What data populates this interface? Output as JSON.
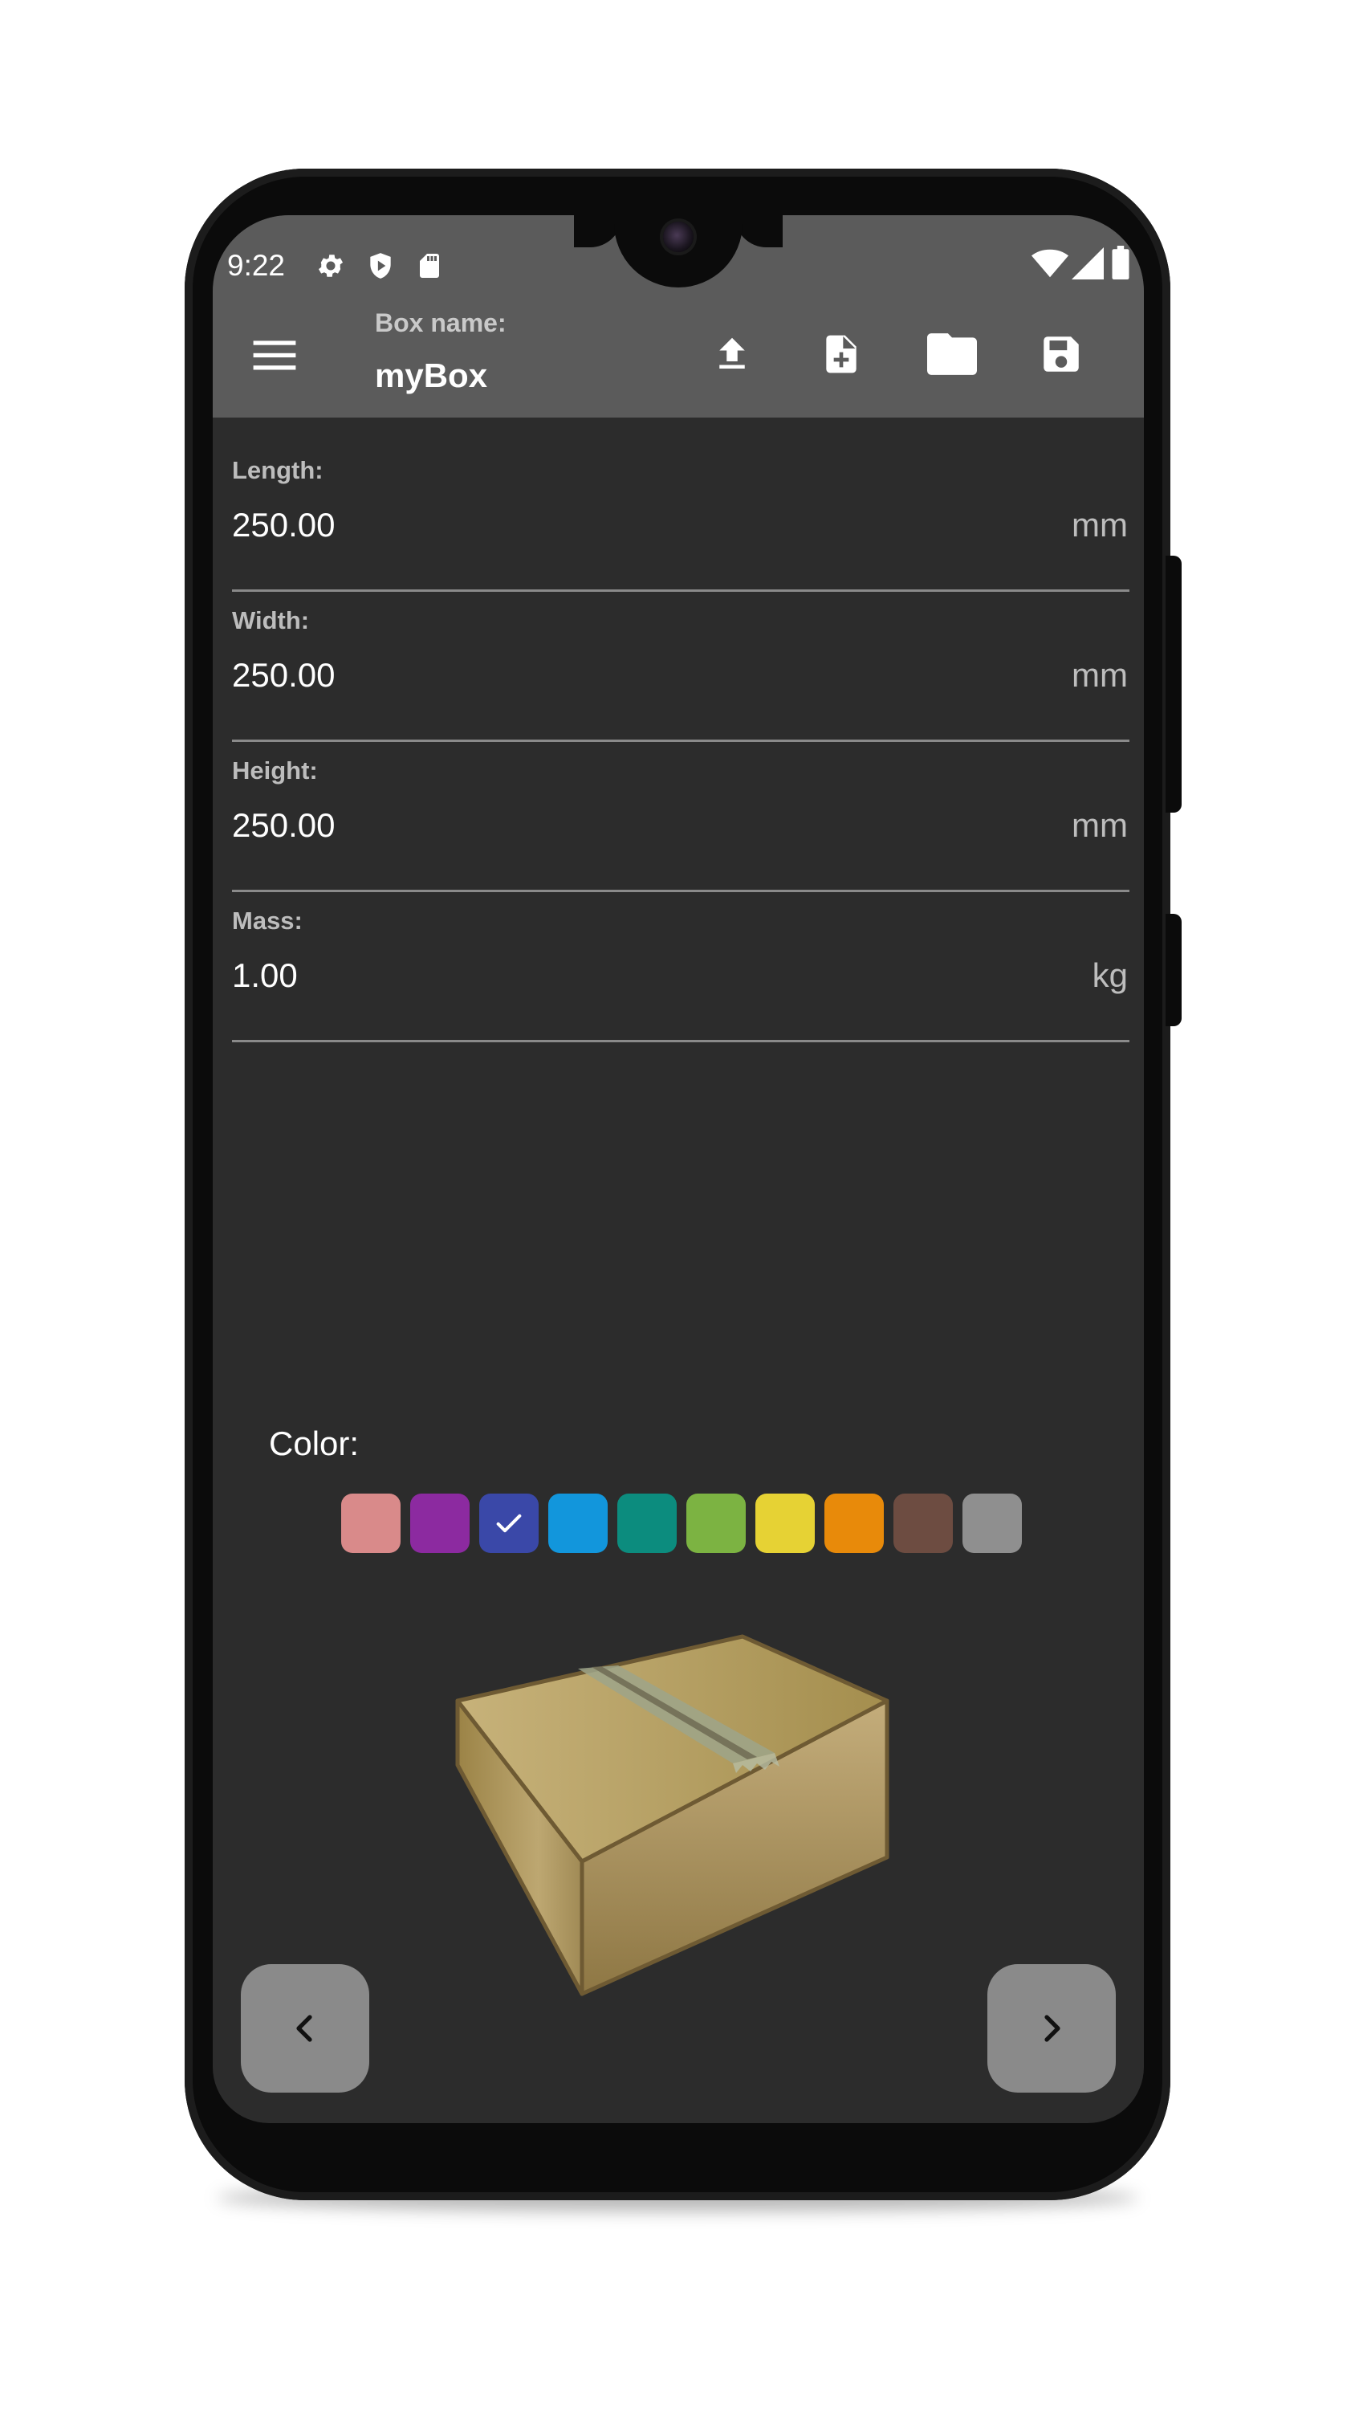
{
  "status_bar": {
    "time": "9:22",
    "left_icons": [
      "gear-icon",
      "shield-play-icon",
      "sd-card-icon"
    ],
    "right_icons": [
      "wifi-icon",
      "cell-signal-icon",
      "battery-icon"
    ]
  },
  "app_bar": {
    "menu_icon": "hamburger-menu-icon",
    "box_name_label": "Box name:",
    "box_name_value": "myBox",
    "actions": [
      "upload-icon",
      "new-file-icon",
      "folder-icon",
      "save-icon"
    ]
  },
  "fields": [
    {
      "label": "Length:",
      "value": "250.00",
      "unit": "mm"
    },
    {
      "label": "Width:",
      "value": "250.00",
      "unit": "mm"
    },
    {
      "label": "Height:",
      "value": "250.00",
      "unit": "mm"
    },
    {
      "label": "Mass:",
      "value": "1.00",
      "unit": "kg"
    }
  ],
  "color_picker": {
    "label": "Color:",
    "selected_index": 2,
    "swatches": [
      "#d98a8a",
      "#8c2aa0",
      "#3a48a8",
      "#1296dc",
      "#0c8c7e",
      "#7cb342",
      "#e6d234",
      "#e88a0a",
      "#6d4c41",
      "#8f8f8f"
    ]
  },
  "preview": {
    "icon": "cardboard-box-icon"
  },
  "navigation": {
    "prev_icon": "chevron-left-icon",
    "next_icon": "chevron-right-icon"
  },
  "theme": {
    "app_bar": "#5b5b5b",
    "background": "#2c2c2c",
    "button": "#8a8a8a"
  }
}
